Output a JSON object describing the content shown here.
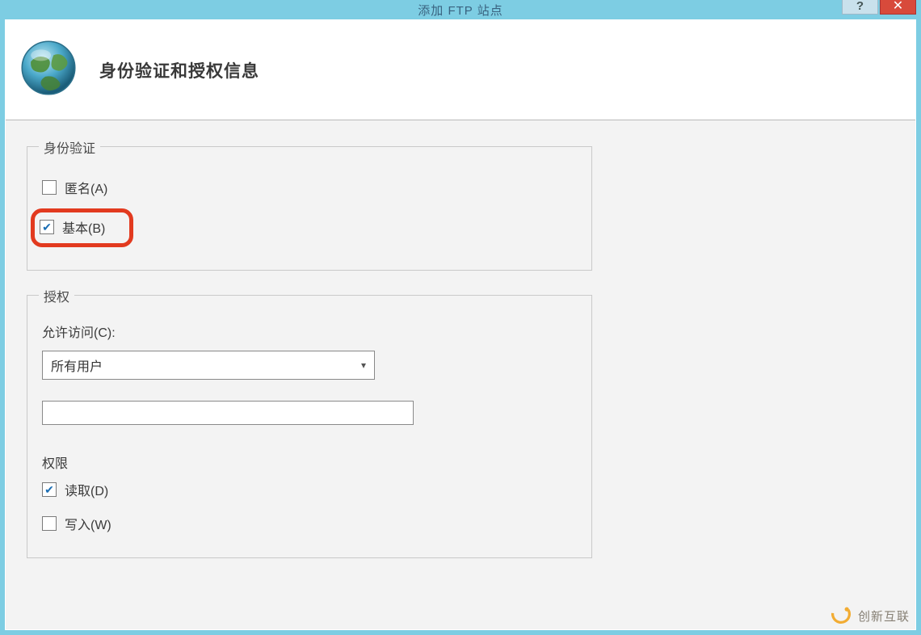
{
  "window": {
    "title": "添加 FTP 站点",
    "help_label": "?",
    "close_label": "✕"
  },
  "header": {
    "heading": "身份验证和授权信息"
  },
  "auth": {
    "legend": "身份验证",
    "anonymous_label": "匿名(A)",
    "basic_label": "基本(B)"
  },
  "authz": {
    "legend": "授权",
    "allow_access_label": "允许访问(C):",
    "dropdown_selected": "所有用户",
    "text_value": "",
    "perm_label": "权限",
    "read_label": "读取(D)",
    "write_label": "写入(W)"
  },
  "watermark": {
    "text": "创新互联"
  }
}
